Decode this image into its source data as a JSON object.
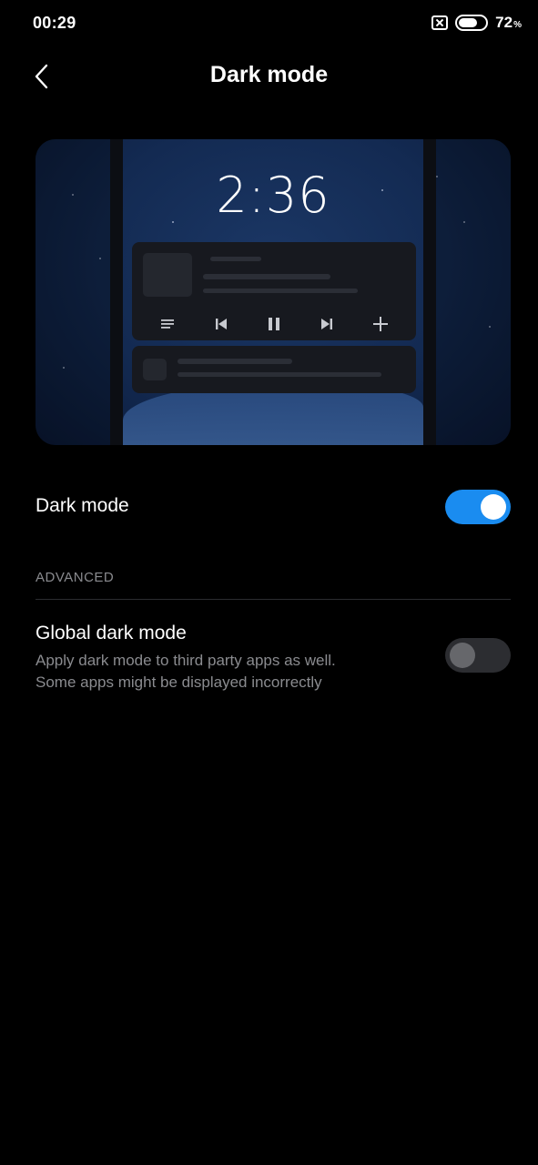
{
  "status_bar": {
    "time": "00:29",
    "battery_level": "72",
    "battery_unit": "%",
    "battery_fraction": 0.72,
    "sim_icon": "sim-x-icon",
    "battery_icon": "battery-icon"
  },
  "header": {
    "title": "Dark mode",
    "back_icon": "chevron-left-icon"
  },
  "preview": {
    "clock": "2:36",
    "media_controls": [
      "playlist-icon",
      "previous-icon",
      "pause-icon",
      "next-icon",
      "plus-icon"
    ]
  },
  "settings": {
    "dark_mode": {
      "label": "Dark mode",
      "enabled": true
    },
    "advanced_header": "ADVANCED",
    "global_dark_mode": {
      "label": "Global dark mode",
      "description_line1": "Apply dark mode to third party apps as well.",
      "description_line2": "Some apps might be displayed incorrectly",
      "enabled": false
    }
  },
  "colors": {
    "background": "#000000",
    "accent": "#1a8cf0",
    "secondary_text": "#8a8b8f",
    "toggle_off_track": "#2c2d31"
  }
}
